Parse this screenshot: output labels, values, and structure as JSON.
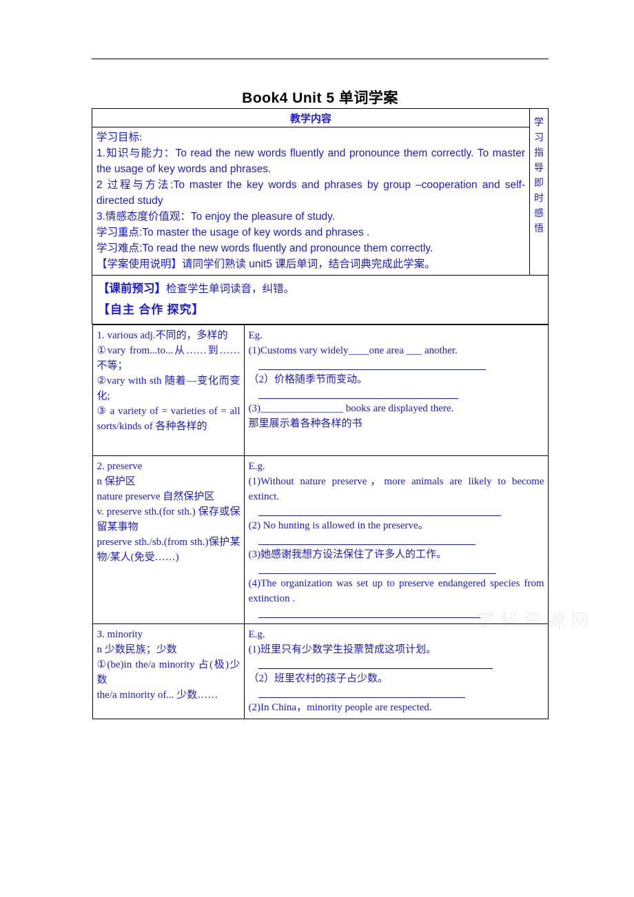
{
  "document": {
    "title": "Book4   Unit 5   单词学案",
    "header_col_main": "教学内容",
    "header_col_side": "学习指导即时感悟"
  },
  "objectives": {
    "heading": "学习目标:",
    "items": [
      "1.知识与能力：To read the new words fluently and pronounce them correctly. To master the usage of key words and phrases.",
      "2 过程与方法:To master the key words and phrases by group –cooperation and self-directed study",
      "3.情感态度价值观：To enjoy the pleasure of study.",
      "学习重点:To master the usage of key words and phrases .",
      "学习难点:To read the new words fluently and pronounce them correctly.",
      "【学案使用说明】请同学们熟读 unit5 课后单词，结合词典完成此学案。"
    ]
  },
  "preparation": {
    "line1_bold": "【课前预习】",
    "line1_normal": "检查学生单词读音，纠错。",
    "line2": "【自主 合作 探究】"
  },
  "entries": [
    {
      "left": [
        "1. various   adj.不同的，多样的",
        "①vary from...to...从……到……不等；",
        "②vary with sth 随着—变化而变化;",
        "③ a variety of = varieties of = all sorts/kinds of 各种各样的"
      ],
      "right": {
        "eg_label": "Eg.",
        "items": [
          {
            "text": "(1)Customs vary widely____one area ___ another.",
            "line": "w1"
          },
          {
            "text": "（2）价格随季节而变动。",
            "line": "w2"
          },
          {
            "text": "(3)________________ books are displayed there.",
            "line": null
          },
          {
            "text": "那里展示着各种各样的书",
            "line": null
          }
        ]
      }
    },
    {
      "left": [
        "2. preserve",
        "n 保护区",
        "nature preserve 自然保护区",
        "v. preserve sth.(for sth.) 保存或保留某事物",
        "preserve   sth./sb.(from sth.)保护某物/某人(免受……)"
      ],
      "right": {
        "eg_label": "E.g.",
        "items": [
          {
            "text": "(1)Without nature preserve，more animals are likely to become extinct.",
            "line": "w5"
          },
          {
            "text": "(2) No hunting is allowed in the preserve。",
            "line": "w6"
          },
          {
            "text": "(3)她感谢我想方设法保住了许多人的工作。",
            "line": "w7"
          },
          {
            "text": "(4)The organization was set up to preserve endangered species from extinction .",
            "line": "w8"
          }
        ]
      }
    },
    {
      "left": [
        "3. minority",
        "n 少数民族；少数",
        "①(be)in the/a minority 占(极)少数",
        "the/a minority of... 少数……"
      ],
      "right": {
        "eg_label": "E.g.",
        "items": [
          {
            "text": "(1)班里只有少数学生投票赞成这项计划。",
            "line": "w3"
          },
          {
            "text": "（2）班里农村的孩子占少数。",
            "line": "w9"
          },
          {
            "text": "(2)In China，minority people are respected.",
            "line": null
          }
        ]
      }
    }
  ],
  "watermark": "学科资源网"
}
